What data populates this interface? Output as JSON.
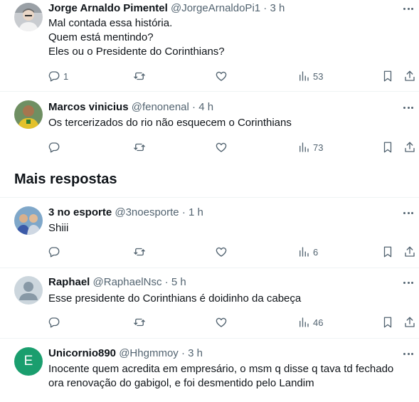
{
  "section_title": "Mais respostas",
  "tweets": [
    {
      "name": "Jorge Arnaldo Pimentel",
      "handle": "@JorgeArnaldoPi1",
      "sep": "·",
      "time": "3 h",
      "lines": [
        "Mal contada essa história.",
        "Quem está mentindo?",
        "Eles ou o Presidente do Corinthians?"
      ],
      "replies": "1",
      "reposts": "",
      "likes": "",
      "views": "53"
    },
    {
      "name": "Marcos vinicius",
      "handle": "@fenonenal",
      "sep": "·",
      "time": "4 h",
      "lines": [
        "Os tercerizados do rio não esquecem o Corinthians"
      ],
      "replies": "",
      "reposts": "",
      "likes": "",
      "views": "73"
    },
    {
      "name": "3 no esporte",
      "handle": "@3noesporte",
      "sep": "·",
      "time": "1 h",
      "lines": [
        "Shiii"
      ],
      "replies": "",
      "reposts": "",
      "likes": "",
      "views": "6"
    },
    {
      "name": "Raphael",
      "handle": "@RaphaelNsc",
      "sep": "·",
      "time": "5 h",
      "lines": [
        "Esse presidente do Corinthians é doidinho da cabeça"
      ],
      "replies": "",
      "reposts": "",
      "likes": "",
      "views": "46"
    },
    {
      "name": "Unicornio890",
      "handle": "@Hhgmmoy",
      "sep": "·",
      "time": "3 h",
      "avatar_letter": "E",
      "lines": [
        "Inocente quem acredita em empresário, o msm q disse q tava td fechado",
        "ora renovação do gabigol, e foi desmentido pelo Landim"
      ],
      "replies": "",
      "reposts": "",
      "likes": "",
      "views": ""
    }
  ],
  "colors": {
    "text": "#0f1419",
    "muted": "#536471",
    "divider": "#eff3f4",
    "avatar_e": "#1a9e6e"
  },
  "icons": [
    "reply-icon",
    "repost-icon",
    "like-icon",
    "views-icon",
    "bookmark-icon",
    "share-icon",
    "more-icon"
  ]
}
